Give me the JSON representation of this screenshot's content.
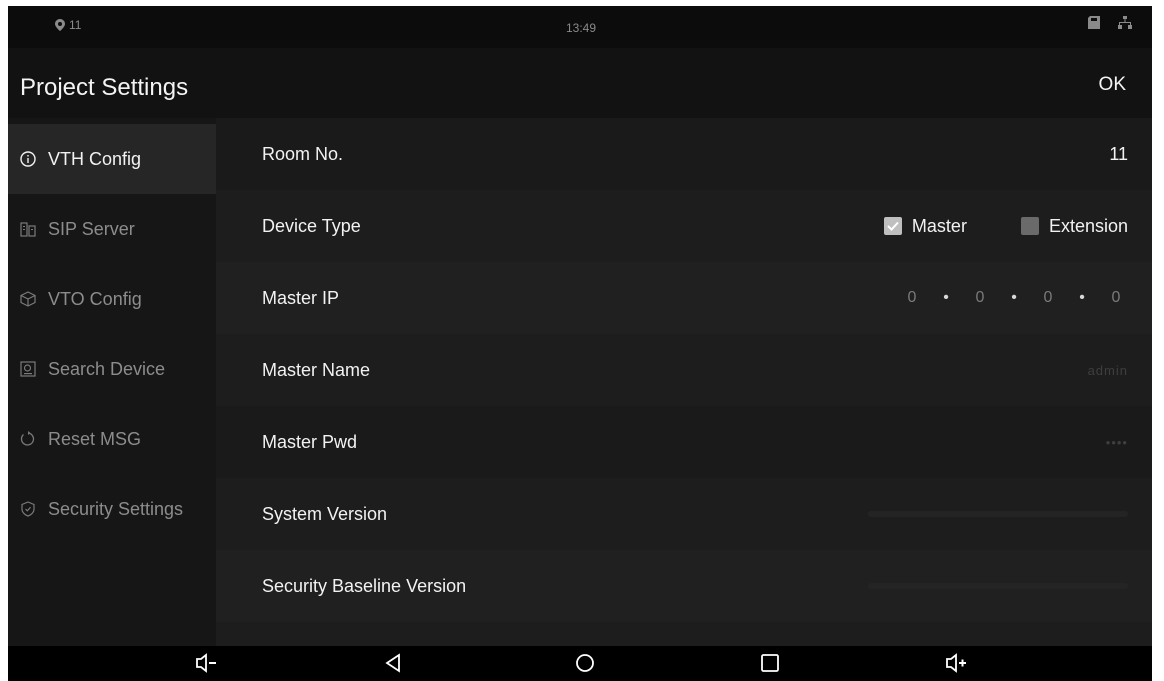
{
  "status_bar": {
    "left_text": "11",
    "time": "13:49",
    "left_icon": "location-pin-icon",
    "right_icons": [
      "sd-card-icon",
      "network-icon"
    ]
  },
  "header": {
    "title": "Project Settings",
    "ok_label": "OK"
  },
  "sidebar": {
    "items": [
      {
        "label": "VTH Config",
        "icon": "info-icon",
        "active": true
      },
      {
        "label": "SIP Server",
        "icon": "server-icon",
        "active": false
      },
      {
        "label": "VTO Config",
        "icon": "cube-icon",
        "active": false
      },
      {
        "label": "Search Device",
        "icon": "search-device-icon",
        "active": false
      },
      {
        "label": "Reset MSG",
        "icon": "reset-icon",
        "active": false
      },
      {
        "label": "Security Settings",
        "icon": "shield-icon",
        "active": false
      }
    ]
  },
  "settings": {
    "room_no": {
      "label": "Room No.",
      "value": "11"
    },
    "device_type": {
      "label": "Device Type",
      "master_label": "Master",
      "master_checked": true,
      "extension_label": "Extension",
      "extension_checked": false
    },
    "master_ip": {
      "label": "Master IP",
      "octets": [
        "0",
        "0",
        "0",
        "0"
      ]
    },
    "master_name": {
      "label": "Master Name",
      "value": "admin"
    },
    "master_pwd": {
      "label": "Master Pwd",
      "value": "••••"
    },
    "system_version": {
      "label": "System Version"
    },
    "security_baseline_version": {
      "label": "Security Baseline Version"
    }
  },
  "navbar": {
    "icons": [
      "volume-down-icon",
      "back-icon",
      "home-icon",
      "recent-apps-icon",
      "volume-up-icon"
    ]
  },
  "colors": {
    "background": "#151515",
    "active_item": "#262626",
    "text": "#f2f2f2",
    "muted_text": "#8c8c8c"
  }
}
